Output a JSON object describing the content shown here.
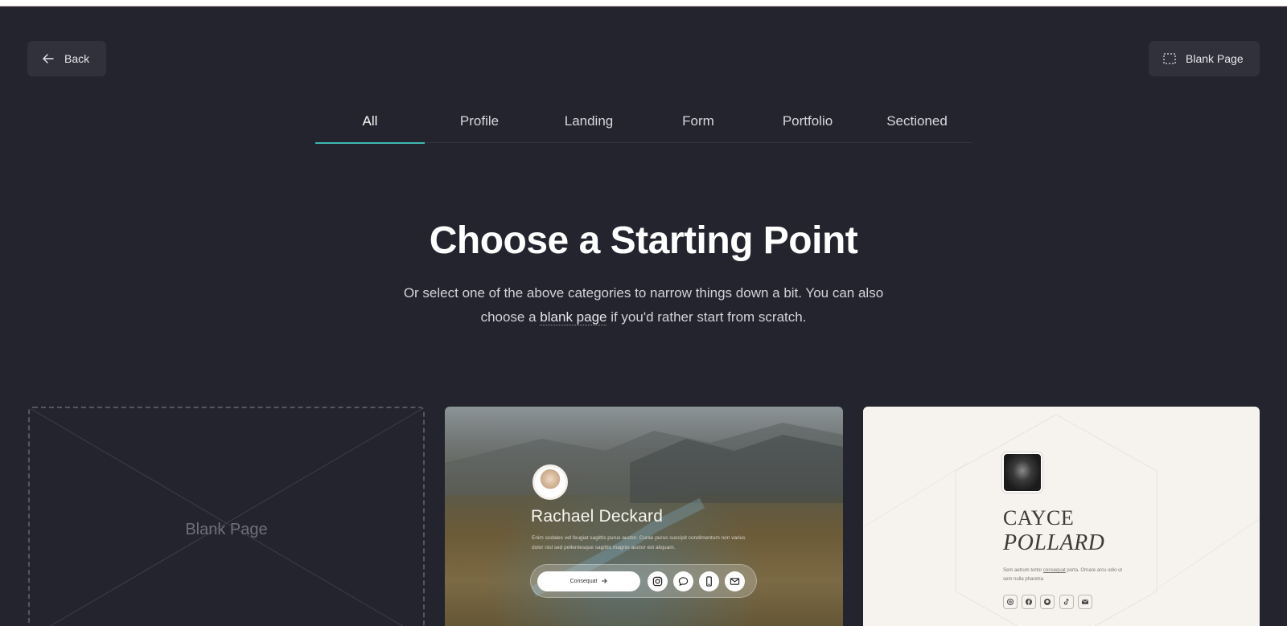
{
  "header": {
    "back_label": "Back",
    "blank_page_label": "Blank Page"
  },
  "tabs": [
    {
      "label": "All",
      "active": true
    },
    {
      "label": "Profile",
      "active": false
    },
    {
      "label": "Landing",
      "active": false
    },
    {
      "label": "Form",
      "active": false
    },
    {
      "label": "Portfolio",
      "active": false
    },
    {
      "label": "Sectioned",
      "active": false
    }
  ],
  "hero": {
    "title": "Choose a Starting Point",
    "subtitle_before": "Or select one of the above categories to narrow things down a bit. You can also choose a ",
    "subtitle_link": "blank page",
    "subtitle_after": " if you'd rather start from scratch."
  },
  "templates": {
    "blank": {
      "label": "Blank Page"
    },
    "profile": {
      "name": "Rachael Deckard",
      "description": "Enim sodales vel feugiat sagittis purus auctor. Curae purus suscipit condimentum non varius dolor nisl sed pellentesque sagittis magnis auctor est aliquam.",
      "cta_label": "Consequat",
      "socials": [
        "instagram-icon",
        "chat-icon",
        "phone-icon",
        "mail-icon"
      ]
    },
    "cayce": {
      "name_line1": "CAYCE",
      "name_line2": "POLLARD",
      "description_before": "Sem aetrum tortor ",
      "description_link": "consequat",
      "description_after": " porta. Ornare arcu odio ut sem nulla pharetra.",
      "socials": [
        "threads-icon",
        "facebook-icon",
        "github-icon",
        "tiktok-icon",
        "mail-icon"
      ]
    }
  },
  "colors": {
    "background": "#23242d",
    "button_bg": "#30313b",
    "tab_indicator": "#3fb8b0",
    "heading": "#ffffff"
  }
}
